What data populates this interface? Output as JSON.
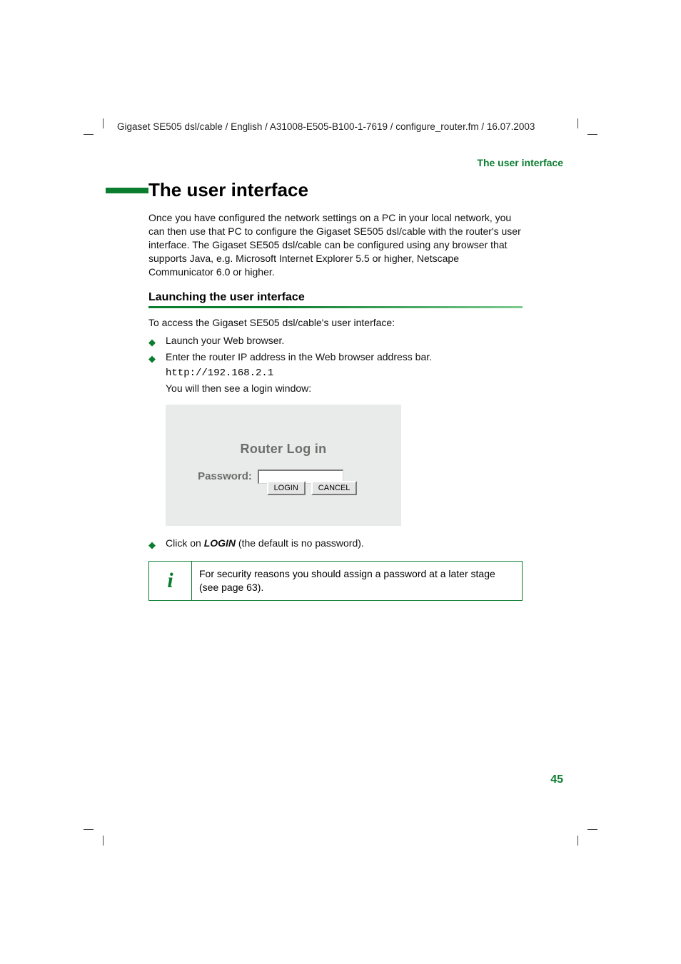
{
  "header_line": "Gigaset SE505 dsl/cable / English / A31008-E505-B100-1-7619 / configure_router.fm / 16.07.2003",
  "running_head": "The user interface",
  "title": "The user interface",
  "intro": "Once you have configured the network settings on a PC in your local network, you can then use that PC to configure the Gigaset SE505 dsl/cable with the router's user interface. The Gigaset SE505 dsl/cable can be configured using any browser that supports Java, e.g. Microsoft Internet Explorer 5.5 or higher, Netscape Communicator 6.0 or higher.",
  "h2": "Launching the user interface",
  "access_line": "To access the Gigaset SE505 dsl/cable's user interface:",
  "bullets": {
    "b1": "Launch your Web browser.",
    "b2": "Enter the router IP address in the Web browser address bar."
  },
  "url": "http://192.168.2.1",
  "after_url": "You will then see a login window:",
  "shot": {
    "title": "Router Log in",
    "password_label": "Password:",
    "login": "LOGIN",
    "cancel": "CANCEL"
  },
  "click_line_pre": "Click on ",
  "click_login": "LOGIN",
  "click_line_post": " (the default is no password).",
  "note_icon": "i",
  "note_text": "For security reasons you should assign a password at a later stage (see page 63).",
  "page_number": "45"
}
